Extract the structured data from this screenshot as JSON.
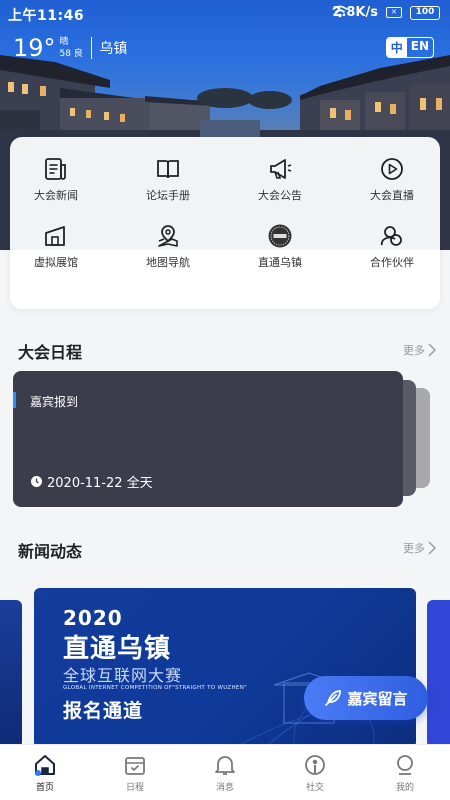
{
  "status_bar": {
    "time": "上午11:46",
    "net_speed": "2.8K/s",
    "battery": "100"
  },
  "weather": {
    "temperature": "19°",
    "condition": "晴",
    "aqi": "58 良",
    "city": "乌镇"
  },
  "language": {
    "zh": "中",
    "en": "EN"
  },
  "menu": [
    {
      "label": "大会新闻",
      "icon": "news-icon"
    },
    {
      "label": "论坛手册",
      "icon": "book-icon"
    },
    {
      "label": "大会公告",
      "icon": "megaphone-icon"
    },
    {
      "label": "大会直播",
      "icon": "play-icon"
    },
    {
      "label": "虚拟展馆",
      "icon": "pavilion-icon"
    },
    {
      "label": "地图导航",
      "icon": "map-icon"
    },
    {
      "label": "直通乌镇",
      "icon": "badge-icon"
    },
    {
      "label": "合作伙伴",
      "icon": "partner-icon"
    }
  ],
  "schedule": {
    "title": "大会日程",
    "more": "更多",
    "item_title": "嘉宾报到",
    "item_time": "2020-11-22 全天"
  },
  "news": {
    "title": "新闻动态",
    "more": "更多",
    "banner": {
      "year": "2020",
      "line1": "直通乌镇",
      "line2": "全球互联网大赛",
      "en": "GLOBAL INTERNET COMPETITION OF\"STRAIGHT TO WUZHEN\"",
      "register": "报名通道"
    }
  },
  "guest_message": "嘉宾留言",
  "bottom_nav": [
    {
      "label": "首页",
      "icon": "home-icon",
      "active": true
    },
    {
      "label": "日程",
      "icon": "calendar-icon",
      "active": false
    },
    {
      "label": "消息",
      "icon": "bell-icon",
      "active": false
    },
    {
      "label": "社交",
      "icon": "social-icon",
      "active": false
    },
    {
      "label": "我的",
      "icon": "profile-icon",
      "active": false
    }
  ],
  "colors": {
    "primary": "#2f5fe0",
    "card_dark": "#3c3d4b",
    "accent_bar": "#2d8cff"
  }
}
